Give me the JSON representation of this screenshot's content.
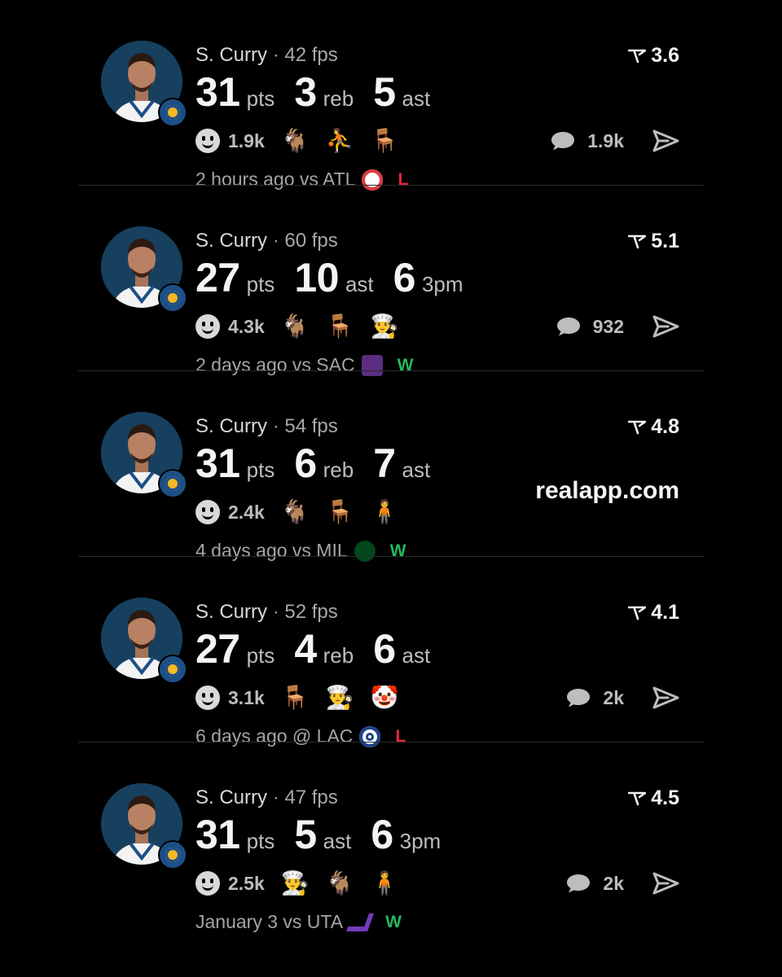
{
  "colors": {
    "background": "#000000",
    "loss": "#e0283a",
    "win": "#25b85c",
    "divider": "#2a2a2a"
  },
  "posts": [
    {
      "player": "S. Curry",
      "fps": "42 fps",
      "rating": "3.6",
      "stats": [
        {
          "num": "31",
          "label": "pts"
        },
        {
          "num": "3",
          "label": "reb"
        },
        {
          "num": "5",
          "label": "ast"
        }
      ],
      "reaction_count": "1.9k",
      "emojis": [
        "🐐",
        "⛹️",
        "🪑"
      ],
      "comments": "1.9k",
      "time": "2 hours ago vs ATL",
      "opponent_logo": "hawks-logo",
      "result": "L"
    },
    {
      "player": "S. Curry",
      "fps": "60 fps",
      "rating": "5.1",
      "stats": [
        {
          "num": "27",
          "label": "pts"
        },
        {
          "num": "10",
          "label": "ast"
        },
        {
          "num": "6",
          "label": "3pm"
        }
      ],
      "reaction_count": "4.3k",
      "emojis": [
        "🐐",
        "🪑",
        "👨‍🍳"
      ],
      "comments": "932",
      "time": "2 days ago vs SAC",
      "opponent_logo": "kings-logo",
      "result": "W"
    },
    {
      "player": "S. Curry",
      "fps": "54 fps",
      "rating": "4.8",
      "stats": [
        {
          "num": "31",
          "label": "pts"
        },
        {
          "num": "6",
          "label": "reb"
        },
        {
          "num": "7",
          "label": "ast"
        }
      ],
      "reaction_count": "2.4k",
      "emojis": [
        "🐐",
        "🪑",
        "🧍"
      ],
      "promo": "realapp.com",
      "time": "4 days ago vs MIL",
      "opponent_logo": "bucks-logo",
      "result": "W"
    },
    {
      "player": "S. Curry",
      "fps": "52 fps",
      "rating": "4.1",
      "stats": [
        {
          "num": "27",
          "label": "pts"
        },
        {
          "num": "4",
          "label": "reb"
        },
        {
          "num": "6",
          "label": "ast"
        }
      ],
      "reaction_count": "3.1k",
      "emojis": [
        "🪑",
        "👨‍🍳",
        "🤡"
      ],
      "comments": "2k",
      "time": "6 days ago @ LAC",
      "opponent_logo": "clippers-logo",
      "result": "L"
    },
    {
      "player": "S. Curry",
      "fps": "47 fps",
      "rating": "4.5",
      "stats": [
        {
          "num": "31",
          "label": "pts"
        },
        {
          "num": "5",
          "label": "ast"
        },
        {
          "num": "6",
          "label": "3pm"
        }
      ],
      "reaction_count": "2.5k",
      "emojis": [
        "👨‍🍳",
        "🐐",
        "🧍"
      ],
      "comments": "2k",
      "time": "January 3 vs UTA",
      "opponent_logo": "jazz-logo",
      "result": "W"
    }
  ]
}
